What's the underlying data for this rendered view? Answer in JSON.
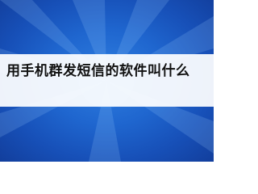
{
  "article": {
    "title": "用手机群发短信的软件叫什么"
  },
  "colors": {
    "background_center": "#2f7fe0",
    "background_edge": "#123e9c",
    "banner": "#ffffff",
    "title_text": "#111111"
  }
}
